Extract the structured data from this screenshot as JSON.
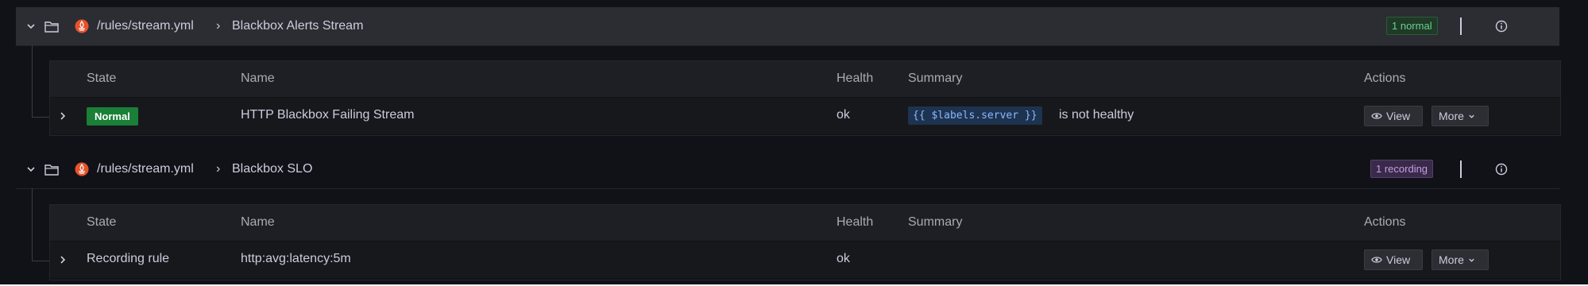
{
  "groups": [
    {
      "path": "/rules/stream.yml",
      "separator": "›",
      "name": "Blackbox Alerts Stream",
      "badge": "1 normal",
      "columns": {
        "state": "State",
        "name": "Name",
        "health": "Health",
        "summary": "Summary",
        "actions": "Actions"
      },
      "rule": {
        "state": "Normal",
        "name": "HTTP Blackbox Failing Stream",
        "health": "ok",
        "summary_code": "{{ $labels.server }}",
        "summary_text": "is not healthy",
        "view_label": "View",
        "more_label": "More"
      }
    },
    {
      "path": "/rules/stream.yml",
      "separator": "›",
      "name": "Blackbox SLO",
      "badge": "1 recording",
      "columns": {
        "state": "State",
        "name": "Name",
        "health": "Health",
        "summary": "Summary",
        "actions": "Actions"
      },
      "rule": {
        "state": "Recording rule",
        "name": "http:avg:latency:5m",
        "health": "ok",
        "view_label": "View",
        "more_label": "More"
      }
    }
  ],
  "colors": {
    "background": "#111217",
    "normal_badge": "#6ccf8e",
    "recording_badge": "#c79de0",
    "state_normal": "#1a7f37",
    "prometheus_logo": "#e6522c"
  },
  "icons": [
    "chevron-down-icon",
    "folder-icon",
    "prometheus-icon",
    "info-icon",
    "chevron-right-icon",
    "eye-icon"
  ]
}
